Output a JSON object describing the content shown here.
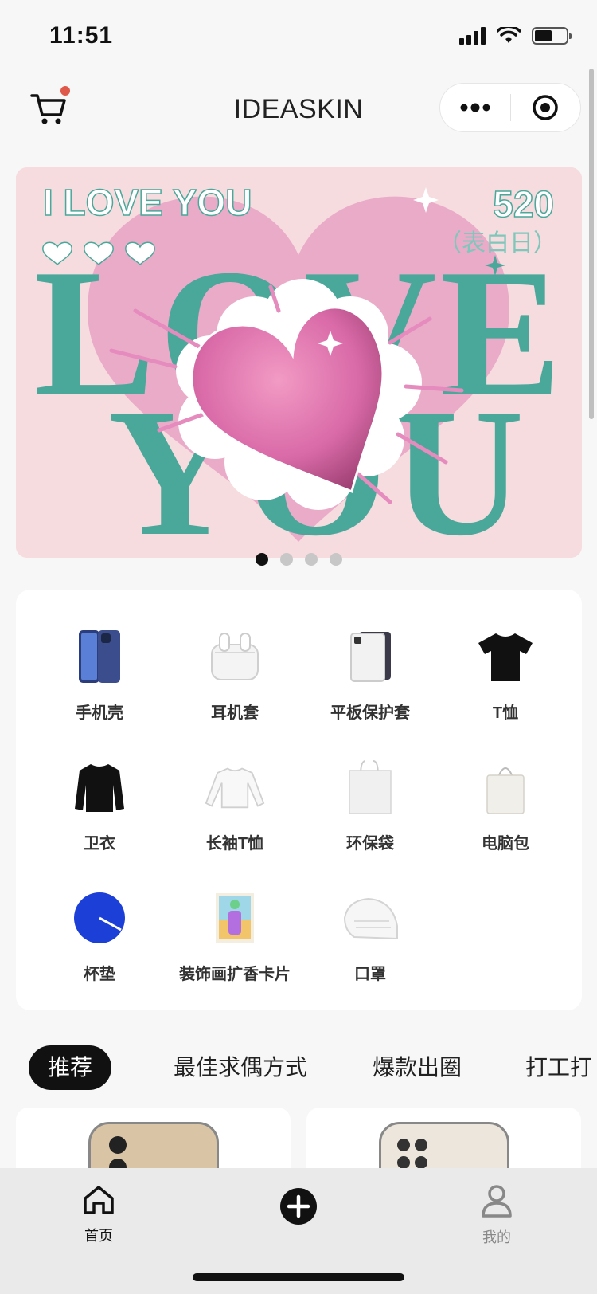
{
  "status_bar": {
    "time": "11:51"
  },
  "header": {
    "title": "IDEASKIN",
    "cart_icon": "cart-icon",
    "more_icon": "more-dots-icon",
    "target_icon": "record-target-icon"
  },
  "banner": {
    "headline": "I LOVE YOU",
    "date": "520",
    "subtitle": "（表白日）",
    "big_text_top": "LOVE",
    "big_text_bottom": "YOU",
    "page_count": 4,
    "active_index": 0
  },
  "categories": [
    {
      "label": "手机壳",
      "icon": "phone-case-icon"
    },
    {
      "label": "耳机套",
      "icon": "earbuds-case-icon"
    },
    {
      "label": "平板保护套",
      "icon": "tablet-case-icon"
    },
    {
      "label": "T恤",
      "icon": "tshirt-icon"
    },
    {
      "label": "卫衣",
      "icon": "sweatshirt-icon"
    },
    {
      "label": "长袖T恤",
      "icon": "long-sleeve-icon"
    },
    {
      "label": "环保袋",
      "icon": "tote-bag-icon"
    },
    {
      "label": "电脑包",
      "icon": "laptop-bag-icon"
    },
    {
      "label": "杯垫",
      "icon": "coaster-icon"
    },
    {
      "label": "装饰画扩香卡片",
      "icon": "art-card-icon"
    },
    {
      "label": "口罩",
      "icon": "mask-icon"
    }
  ],
  "tabs": [
    {
      "label": "推荐",
      "active": true
    },
    {
      "label": "最佳求偶方式",
      "active": false
    },
    {
      "label": "爆款出圈",
      "active": false
    },
    {
      "label": "打工打",
      "active": false
    }
  ],
  "tabbar": {
    "home": {
      "label": "首页",
      "icon": "home-icon"
    },
    "create": {
      "icon": "plus-circle-icon"
    },
    "mine": {
      "label": "我的",
      "icon": "user-icon"
    }
  },
  "colors": {
    "banner_bg": "#f6dcdf",
    "heart_pink": "#e58bbd",
    "teal": "#4aa89a",
    "active_tab": "#111111",
    "cart_badge": "#e0584a"
  }
}
